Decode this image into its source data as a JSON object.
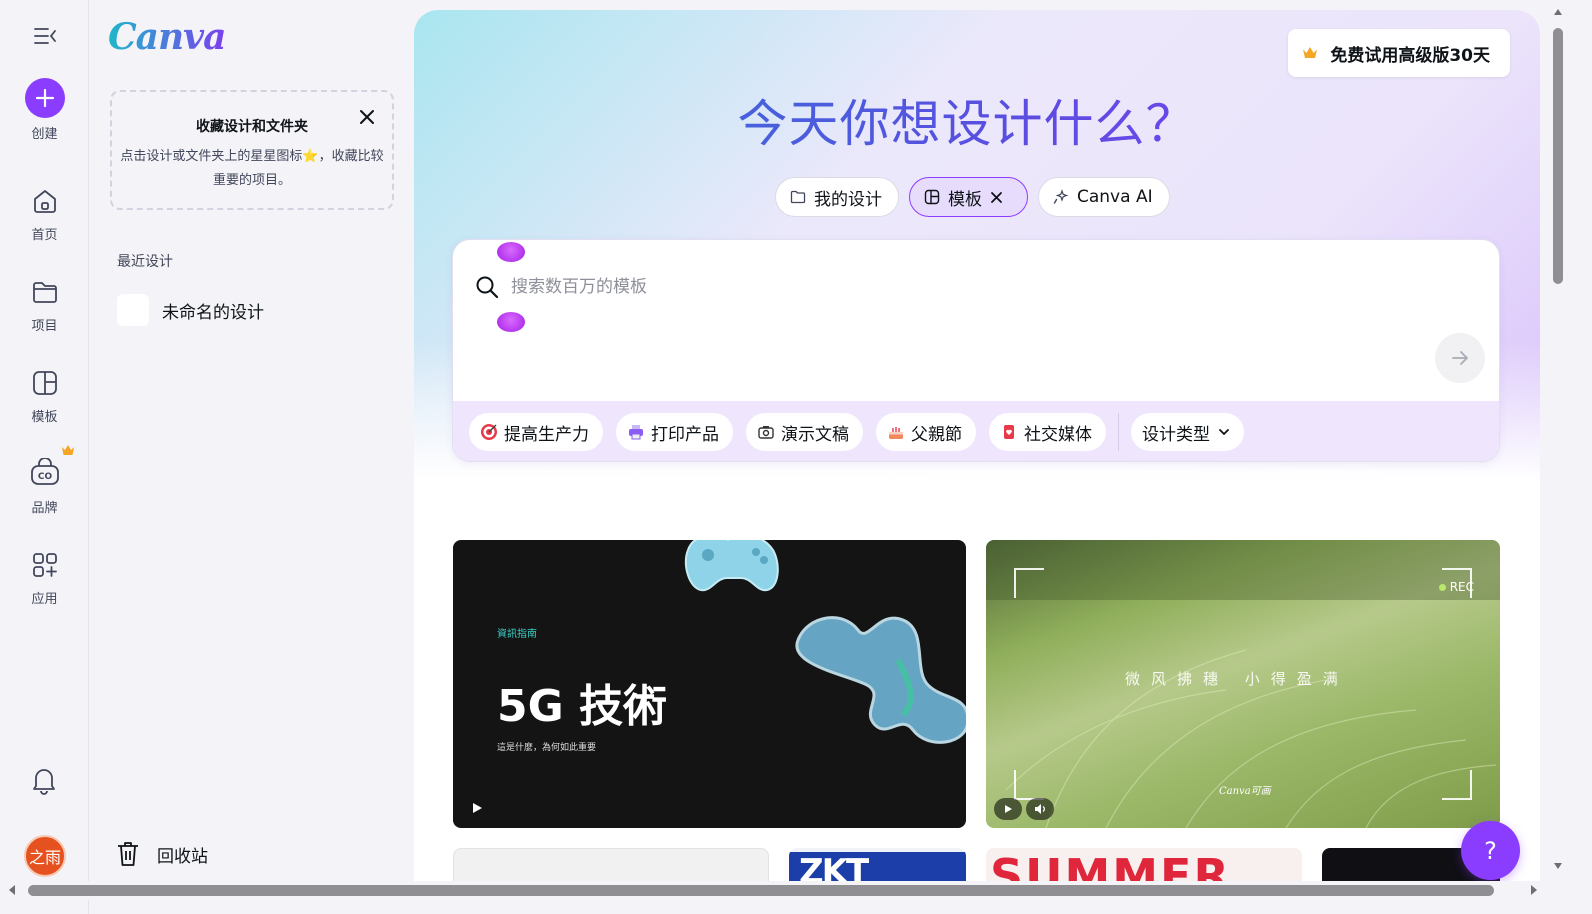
{
  "rail": {
    "items": [
      {
        "label": "创建"
      },
      {
        "label": "首页"
      },
      {
        "label": "项目"
      },
      {
        "label": "模板"
      },
      {
        "label": "品牌"
      },
      {
        "label": "应用"
      }
    ],
    "avatar_text": "之雨"
  },
  "panel": {
    "logo_text": "Canva",
    "favorites": {
      "title": "收藏设计和文件夹",
      "description": "点击设计或文件夹上的星星图标⭐，收藏比较重要的项目。"
    },
    "recent_title": "最近设计",
    "recent_items": [
      {
        "name": "未命名的设计"
      }
    ],
    "trash_label": "回收站"
  },
  "main": {
    "trial_button": "免费试用高级版30天",
    "headline": "今天你想设计什么？",
    "tabs": [
      {
        "label": "我的设计",
        "icon": "folder-icon",
        "active": false
      },
      {
        "label": "模板",
        "icon": "template-icon",
        "active": true
      },
      {
        "label": "Canva AI",
        "icon": "sparkle-icon",
        "active": false
      }
    ],
    "search": {
      "placeholder": "搜索数百万的模板",
      "value": ""
    },
    "chips": [
      {
        "label": "提高生产力",
        "icon": "target-icon"
      },
      {
        "label": "打印产品",
        "icon": "printer-icon"
      },
      {
        "label": "演示文稿",
        "icon": "presentation-icon"
      },
      {
        "label": "父親節",
        "icon": "cake-icon"
      },
      {
        "label": "社交媒体",
        "icon": "heart-badge-icon"
      }
    ],
    "design_type_dropdown": "设计类型",
    "templates": [
      {
        "kicker": "資訊指南",
        "title": "5G 技術",
        "subtitle": "這是什麼，為何如此重要"
      },
      {
        "rec": "REC",
        "poem": "微风拂穗 小得盈满",
        "brand": "Canva可画"
      }
    ],
    "mini_cards": [
      {
        "text": ""
      },
      {
        "text": "ZKT"
      },
      {
        "text": "SUMMER"
      },
      {
        "text": ""
      }
    ]
  },
  "help_button": "?",
  "colors": {
    "accent": "#8b3dff",
    "hero_start": "#a9e6ef",
    "hero_end": "#d9c3fb"
  }
}
